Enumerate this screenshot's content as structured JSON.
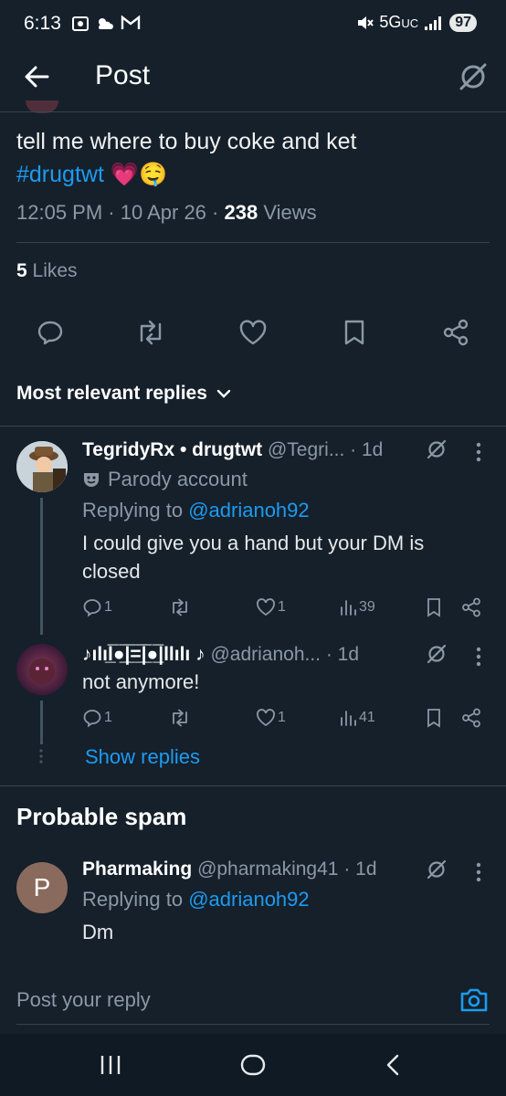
{
  "status": {
    "time": "6:13",
    "network": "5G",
    "network_sub": "UC",
    "battery": "97"
  },
  "header": {
    "title": "Post"
  },
  "tweet": {
    "text": "tell me where to buy coke and ket",
    "hashtag": "#drugtwt",
    "emoji": "💗🤤",
    "time": "12:05 PM",
    "date": "10 Apr 26",
    "views_count": "238",
    "views_label": "Views",
    "likes_count": "5",
    "likes_label": "Likes"
  },
  "sort": {
    "label": "Most relevant replies"
  },
  "replies": [
    {
      "name": "TegridyRx • drugtwt",
      "handle": "@Tegri...",
      "age": "· 1d",
      "badge": "Parody account",
      "replying_prefix": "Replying to",
      "replying_to": "@adrianoh92",
      "text": "I could give you a hand but your DM is closed",
      "replies": "1",
      "likes": "1",
      "views": "39"
    },
    {
      "name": "♪ılıl̲̅̅●̲̅̅|̲̅̅=̲̅̅|̲̅̅●̲̅̅|llılı ♪",
      "handle": "@adrianoh...",
      "age": "· 1d",
      "text": "not anymore!",
      "replies": "1",
      "likes": "1",
      "views": "41"
    }
  ],
  "show_replies": "Show replies",
  "spam_heading": "Probable spam",
  "spam_reply": {
    "initial": "P",
    "name": "Pharmaking",
    "handle": "@pharmaking41",
    "age": "· 1d",
    "replying_prefix": "Replying to",
    "replying_to": "@adrianoh92",
    "text": "Dm"
  },
  "compose": {
    "placeholder": "Post your reply"
  },
  "colors": {
    "background": "#15202b",
    "accent": "#1d9bf0",
    "muted": "#8b98a5"
  }
}
